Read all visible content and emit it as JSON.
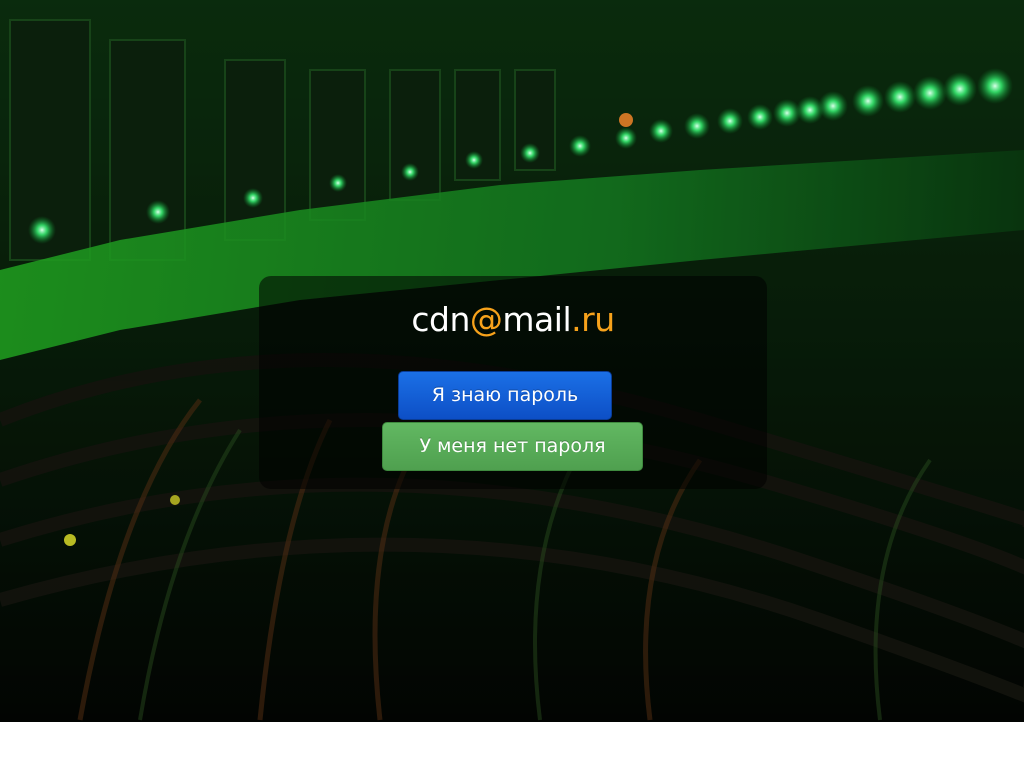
{
  "logo": {
    "part1": "cdn",
    "at": "@",
    "part2": "mail",
    "dot": ".",
    "tld": "ru"
  },
  "buttons": {
    "know_password": "Я знаю пароль",
    "no_password": "У меня нет пароля"
  },
  "colors": {
    "primary": "#1565d8",
    "success": "#5cb85c",
    "logo_accent": "#f7a21b"
  }
}
